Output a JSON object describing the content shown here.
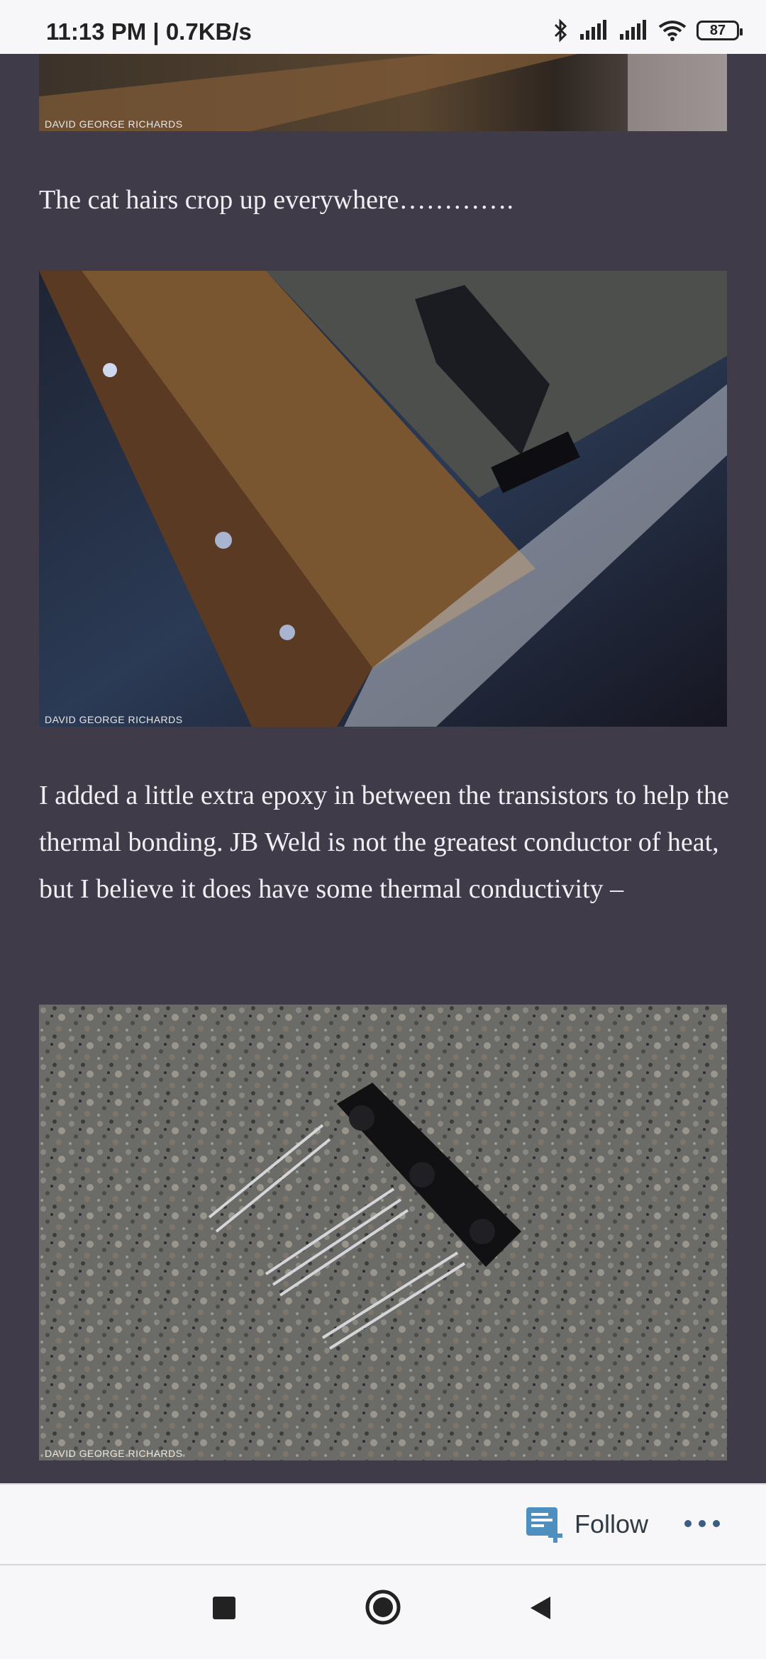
{
  "status_bar": {
    "time": "11:13 PM | 0.7KB/s",
    "battery": "87"
  },
  "article": {
    "photo_credit": "DAVID GEORGE RICHARDS",
    "para1": "The cat hairs crop up everywhere………….",
    "para2": "I added a little extra epoxy in between the transistors to help the thermal bonding. JB Weld is not the greatest conductor of heat, but I believe it does have some thermal conductivity –"
  },
  "follow_bar": {
    "follow_label": "Follow"
  },
  "colors": {
    "background": "#3f3b48",
    "text": "#f1eff4",
    "bar": "#f7f7f9",
    "follow_icon": "#4f8fbf"
  }
}
